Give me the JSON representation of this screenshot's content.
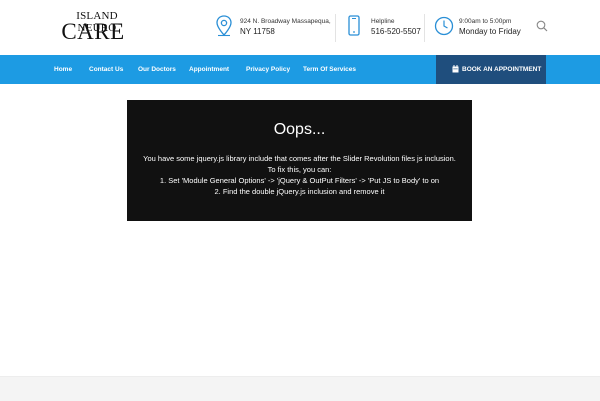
{
  "header": {
    "logo": {
      "line1": "ISLAND NEURO",
      "line2": "CARE"
    },
    "address": {
      "line1": "924 N. Broadway Massapequa,",
      "line2": "NY 11758",
      "icon": "map-pin-icon"
    },
    "helpline": {
      "label": "Helpline",
      "phone": "516-520-5507",
      "icon": "mobile-phone-icon"
    },
    "hours": {
      "time": "9:00am to 5:00pm",
      "days": "Monday to Friday",
      "icon": "clock-icon"
    },
    "search_icon": "search-icon"
  },
  "nav": {
    "items": [
      {
        "label": "Home"
      },
      {
        "label": "Contact Us"
      },
      {
        "label": "Our Doctors"
      },
      {
        "label": "Appointment"
      },
      {
        "label": "Privacy Policy"
      },
      {
        "label": "Term Of Services"
      }
    ],
    "book_button": {
      "label": "BOOK AN APPOINTMENT",
      "icon": "calendar-icon"
    }
  },
  "error": {
    "title": "Oops...",
    "lines": [
      "You have some jquery.js library include that comes after the Slider Revolution files js inclusion.",
      "To fix this, you can:",
      "1. Set 'Module General Options' -> 'jQuery & OutPut Filters' -> 'Put JS to Body' to on",
      "2. Find the double jQuery.js inclusion and remove it"
    ]
  },
  "colors": {
    "nav_blue": "#1d9be3",
    "book_button_navy": "#1f4e7d",
    "icon_blue": "#2a8fd6",
    "error_bg": "#111111"
  }
}
